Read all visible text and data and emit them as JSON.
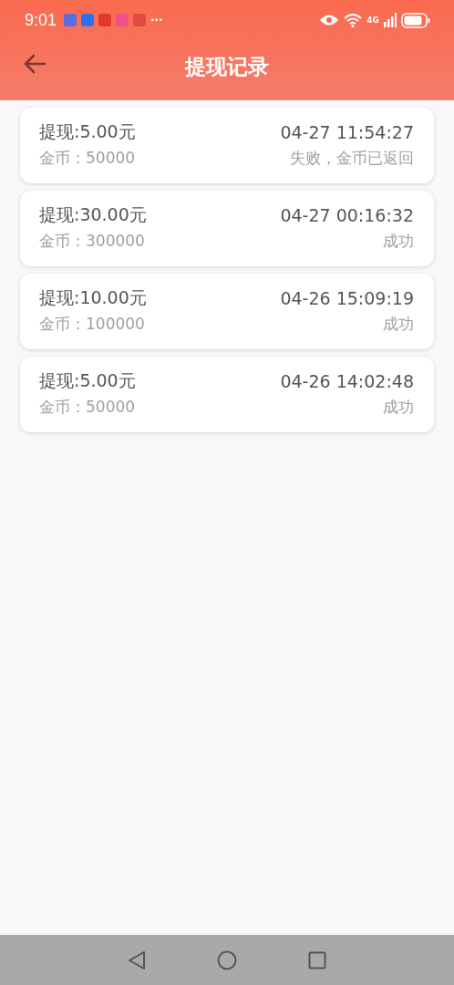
{
  "status_bar": {
    "time": "9:01",
    "more": "···",
    "network": "4G"
  },
  "header": {
    "title": "提现记录"
  },
  "records": [
    {
      "amount": "提现:5.00元",
      "time": "04-27 11:54:27",
      "coins": "金币：50000",
      "status": "失败，金币已返回"
    },
    {
      "amount": "提现:30.00元",
      "time": "04-27 00:16:32",
      "coins": "金币：300000",
      "status": "成功"
    },
    {
      "amount": "提现:10.00元",
      "time": "04-26 15:09:19",
      "coins": "金币：100000",
      "status": "成功"
    },
    {
      "amount": "提现:5.00元",
      "time": "04-26 14:02:48",
      "coins": "金币：50000",
      "status": "成功"
    }
  ]
}
